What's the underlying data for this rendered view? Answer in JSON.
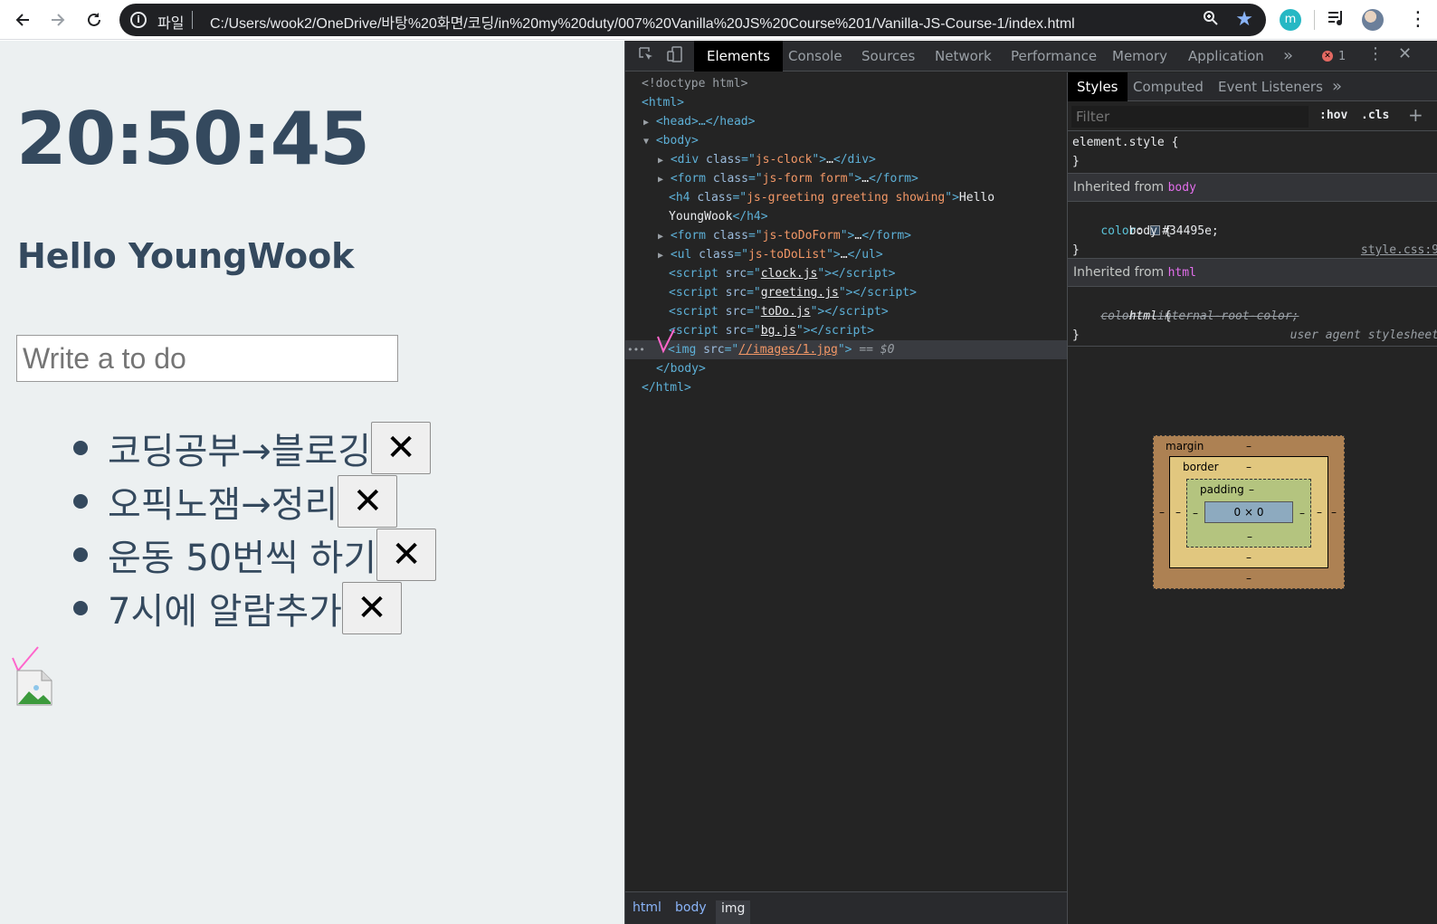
{
  "browser": {
    "scheme_label": "파일",
    "url": "C:/Users/wook2/OneDrive/바탕%20화면/코딩/in%20my%20duty/007%20Vanilla%20JS%20Course%201/Vanilla-JS-Course-1/index.html",
    "extension_label": "m"
  },
  "page": {
    "clock": "20:50:45",
    "greeting": "Hello YoungWook",
    "todo_placeholder": "Write a to do",
    "todos": [
      {
        "text": "코딩공부→블로깅",
        "delete_label": "✕"
      },
      {
        "text": "오픽노잼→정리",
        "delete_label": "✕"
      },
      {
        "text": "운동 50번씩 하기",
        "delete_label": "✕"
      },
      {
        "text": "7시에 알람추가",
        "delete_label": "✕"
      }
    ]
  },
  "devtools": {
    "tabs": [
      "Elements",
      "Console",
      "Sources",
      "Network",
      "Performance",
      "Memory",
      "Application"
    ],
    "active_tab": "Elements",
    "error_count": "1",
    "styles_tabs": [
      "Styles",
      "Computed",
      "Event Listeners"
    ],
    "filter_placeholder": "Filter",
    "hov_label": ":hov",
    "cls_label": ".cls",
    "element_style_selector": "element.style {",
    "close_brace": "}",
    "inherited_label": "Inherited from",
    "inherited_body": "body",
    "inherited_html": "html",
    "body_rule": {
      "selector": "body",
      "source": "style.css:9",
      "property": "color",
      "value": "#34495e;"
    },
    "html_rule": {
      "selector": "html",
      "source": "user agent stylesheet",
      "property": "color",
      "value": "-internal-root-color;"
    },
    "box_model": {
      "margin": "margin",
      "border": "border",
      "padding": "padding",
      "content": "0 × 0",
      "dash": "–"
    },
    "breadcrumbs": [
      "html",
      "body",
      "img"
    ],
    "dom": {
      "doctype": "<!doctype html>",
      "html_open": "<html>",
      "head": "<head>…</head>",
      "body_open": "<body>",
      "div_clock_class": "js-clock",
      "form1_class": "js-form form",
      "h4_class": "js-greeting greeting showing",
      "h4_text_1": "Hello",
      "h4_text_2": "YoungWook",
      "form2_class": "js-toDoForm",
      "ul_class": "js-toDoList",
      "scripts": [
        "clock.js",
        "greeting.js",
        "toDo.js",
        "bg.js"
      ],
      "img_src": "//images/1.jpg",
      "img_suffix": "== $0",
      "body_close": "</body>",
      "html_close": "</html>"
    }
  },
  "colors": {
    "page_bg": "#ecf0f1",
    "text": "#34495e",
    "annotation": "#ff66cc"
  }
}
